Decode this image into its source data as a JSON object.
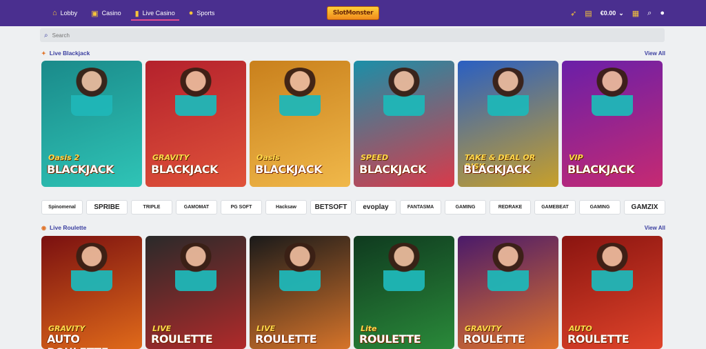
{
  "nav": [
    {
      "label": "Lobby",
      "icon": "home-icon"
    },
    {
      "label": "Casino",
      "icon": "slot-machine-icon"
    },
    {
      "label": "Live Casino",
      "icon": "live-card-icon",
      "active": true
    },
    {
      "label": "Sports",
      "icon": "ball-icon"
    }
  ],
  "logo": {
    "text": "SlotMonster"
  },
  "header": {
    "balance": "€0.00"
  },
  "search": {
    "placeholder": "Search"
  },
  "sections": {
    "blackjack": {
      "title": "Live Blackjack",
      "view_all": "View All"
    },
    "roulette": {
      "title": "Live Roulette",
      "view_all": "View All"
    }
  },
  "blackjack_games": [
    {
      "top": "Oasis 2",
      "main": "BLACKJACK",
      "bg": "#1a8a8a",
      "bg2": "#2fc4b6"
    },
    {
      "top": "GRAVITY",
      "main": "BLACKJACK",
      "bg": "#b4212c",
      "bg2": "#e0533a"
    },
    {
      "top": "Oasis",
      "main": "BLACKJACK",
      "bg": "#c9801c",
      "bg2": "#f0b84a"
    },
    {
      "top": "SPEED",
      "main": "BLACKJACK",
      "bg": "#1b8fa8",
      "bg2": "#d93a4a"
    },
    {
      "top": "TAKE & DEAL OR RISK",
      "main": "BLACKJACK",
      "bg": "#2a5fc2",
      "bg2": "#c8a02a"
    },
    {
      "top": "VIP",
      "main": "BLACKJACK",
      "bg": "#6a1fa8",
      "bg2": "#c62a72"
    }
  ],
  "providers": [
    "Spinomenal",
    "SPRIBE",
    "TRIPLE",
    "GAMOMAT",
    "PG SOFT",
    "Hacksaw",
    "BETSOFT",
    "evoplay",
    "FANTASMA",
    "GAMING",
    "REDRAKE",
    "GAMEBEAT",
    "GAMING",
    "GAMZIX"
  ],
  "roulette_games": [
    {
      "top": "GRAVITY",
      "main": "AUTO ROULETTE",
      "bg": "#7a1010",
      "bg2": "#e06a1a"
    },
    {
      "top": "LIVE",
      "main": "ROULETTE",
      "bg": "#2a2a2a",
      "bg2": "#b02a2a"
    },
    {
      "top": "LIVE",
      "main": "ROULETTE",
      "bg": "#1a1a1a",
      "bg2": "#d6742a"
    },
    {
      "top": "Lite",
      "main": "ROULETTE",
      "bg": "#0f3a1f",
      "bg2": "#2a8a3a"
    },
    {
      "top": "GRAVITY",
      "main": "ROULETTE",
      "bg": "#4a1a6a",
      "bg2": "#e0732a"
    },
    {
      "top": "AUTO",
      "main": "ROULETTE",
      "bg": "#8a1410",
      "bg2": "#e0442a"
    }
  ]
}
